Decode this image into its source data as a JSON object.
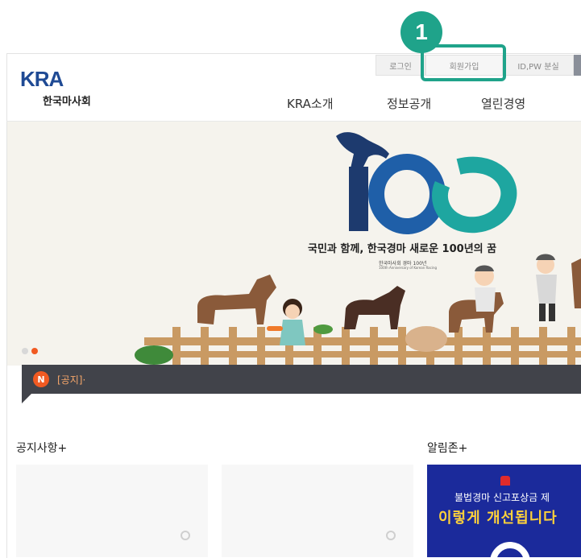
{
  "utility": {
    "login": "로그인",
    "join": "회원가입",
    "find": "ID,PW 분실"
  },
  "callout": {
    "number": "1",
    "color": "#1fa38a"
  },
  "logo": {
    "mark": "KRA",
    "name": "한국마사회"
  },
  "nav": {
    "items": [
      "KRA소개",
      "정보공개",
      "열린경영"
    ]
  },
  "hero": {
    "number": "100",
    "slogan": "국민과 함께, 한국경마 새로운 100년의 꿈",
    "sub_korean": "한국마사회 경마 100년",
    "sub_english": "100th Anniversary of Korean Racing",
    "slide_count": 2,
    "active_slide": 2
  },
  "notice": {
    "badge": "N",
    "text": "[공지]·"
  },
  "sections": {
    "notice_title": "공지사항+",
    "alarm_title": "알림존+"
  },
  "banner": {
    "line1": "불법경마 신고포상금 제",
    "line2": "이렇게 개선됩니다"
  },
  "colors": {
    "brand_blue": "#1f4a94",
    "accent_orange": "#f15a22",
    "teal": "#1fa38a",
    "notice_bar": "#41434a"
  }
}
